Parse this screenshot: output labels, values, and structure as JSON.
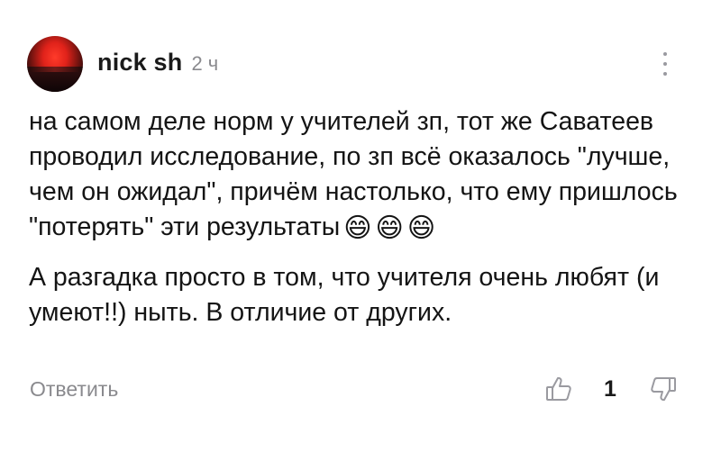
{
  "comment": {
    "author": "nick sh",
    "time_ago": "2 ч",
    "avatar_icon": "sunset-avatar",
    "more_icon": "more-vertical-icon",
    "paragraphs": [
      "на самом деле норм у учителей зп, тот же Саватеев проводил исследование, по зп всё оказалось \"лучше, чем он ожидал\", причём настолько, что ему пришлось \"потерять\" эти результаты",
      "А разгадка просто в том, что учителя очень любят (и умеют!!) ныть. В отличие от других."
    ],
    "emojis": [
      "😄",
      "😄",
      "😄"
    ],
    "reply_label": "Ответить",
    "like_icon": "thumbs-up-icon",
    "dislike_icon": "thumbs-down-icon",
    "vote_count": "1",
    "colors": {
      "text": "#141414",
      "muted": "#8a8a8e",
      "background": "#ffffff"
    }
  }
}
